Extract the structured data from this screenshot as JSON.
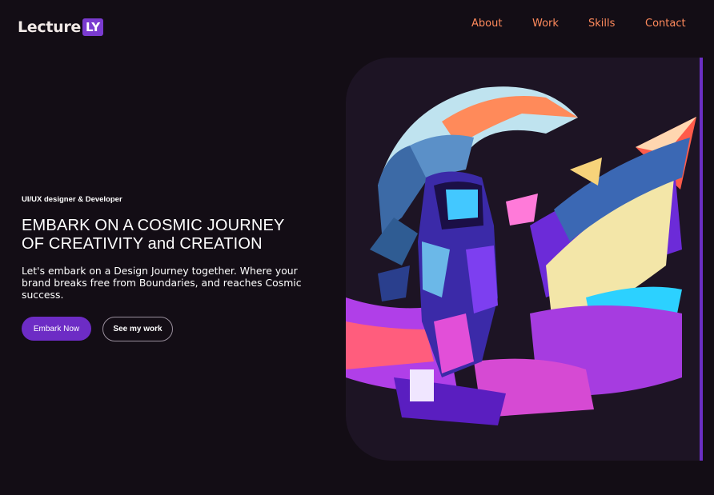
{
  "header": {
    "logo_text": "Lecture",
    "logo_badge": "LY",
    "nav": [
      {
        "label": "About"
      },
      {
        "label": "Work"
      },
      {
        "label": "Skills"
      },
      {
        "label": "Contact"
      }
    ]
  },
  "hero": {
    "eyebrow": "UI/UX designer & Developer",
    "headline_line1": "EMBARK ON A COSMIC JOURNEY",
    "headline_line2": "OF CREATIVITY and CREATION",
    "subtext": "Let's embark on a Design Journey together. Where your brand breaks free from Boundaries, and reaches Cosmic success.",
    "primary_button": "Embark Now",
    "secondary_button": "See my work"
  },
  "illustration": {
    "subject": "astronaut-illustration",
    "colors": {
      "accent": "#6d2cc5",
      "nav": "#ff8a5c",
      "background": "#130d15"
    }
  }
}
